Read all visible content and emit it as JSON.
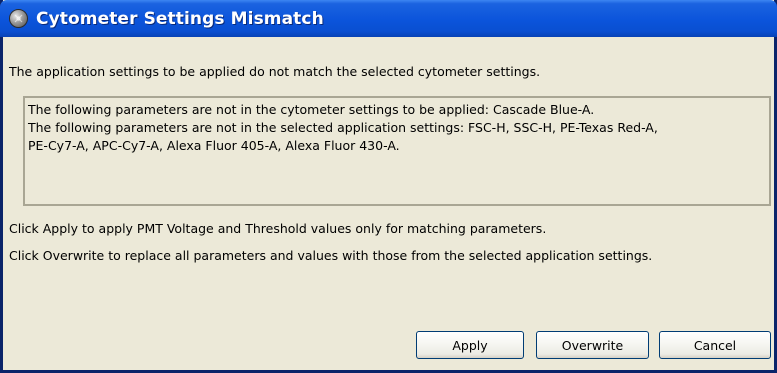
{
  "window": {
    "title": "Cytometer Settings Mismatch",
    "title_icon": "cytometer-app-icon"
  },
  "intro_text": "The application settings to be applied do not match the selected cytometer settings.",
  "details": {
    "lines": [
      "The following parameters are not in the cytometer settings to be applied: Cascade Blue-A.",
      "The following parameters are not in the selected application settings: FSC-H, SSC-H, PE-Texas Red-A,",
      "PE-Cy7-A, APC-Cy7-A, Alexa Fluor 405-A, Alexa Fluor 430-A."
    ]
  },
  "hints": {
    "apply": "Click Apply to apply PMT Voltage and Threshold values only for matching parameters.",
    "overwrite": "Click Overwrite to replace all parameters and values with those from the selected application settings."
  },
  "buttons": {
    "apply": "Apply",
    "overwrite": "Overwrite",
    "cancel": "Cancel"
  },
  "colors": {
    "titlebar": "#0b54db",
    "window_background": "#ece9d8",
    "frame": "#0a246a",
    "button_border": "#003c74"
  }
}
